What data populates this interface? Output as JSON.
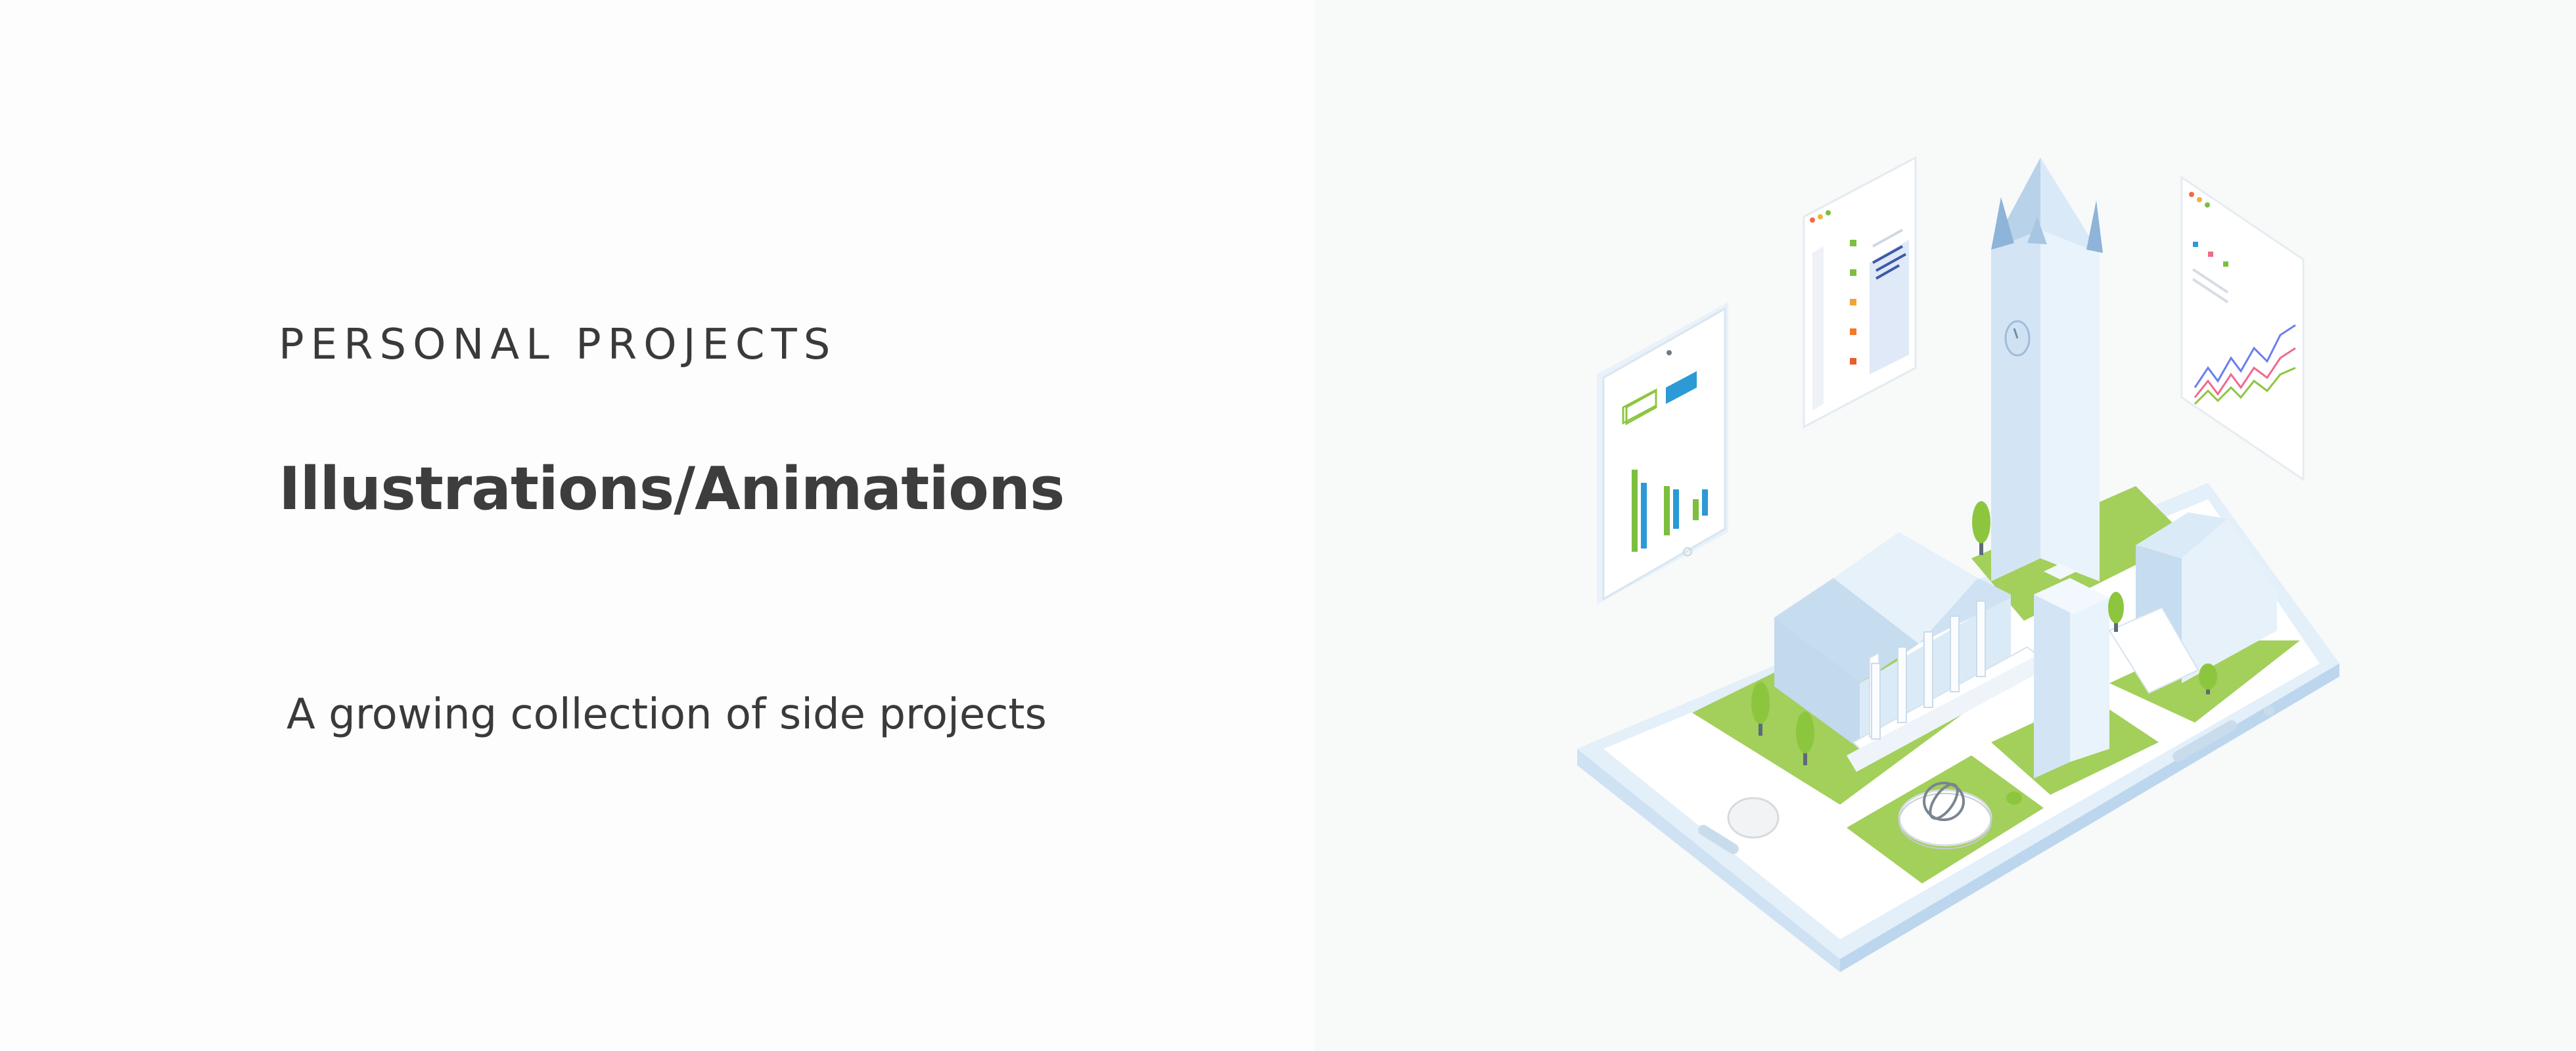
{
  "section": {
    "eyebrow": "PERSONAL PROJECTS",
    "title": "Illustrations/Animations",
    "subtitle": "A growing collection of side projects"
  },
  "illustration": {
    "subject": "isometric-campus-on-tablet",
    "colors": {
      "panel_bg": "#f8f9f9",
      "building": "#dbeaf7",
      "building_shade": "#c2d9ee",
      "lawn": "#a3cf5b",
      "tablet": "#eef5fb",
      "bar_green": "#7cbf3f",
      "bar_blue": "#2b9ad6",
      "accent_orange": "#f0862a"
    }
  }
}
